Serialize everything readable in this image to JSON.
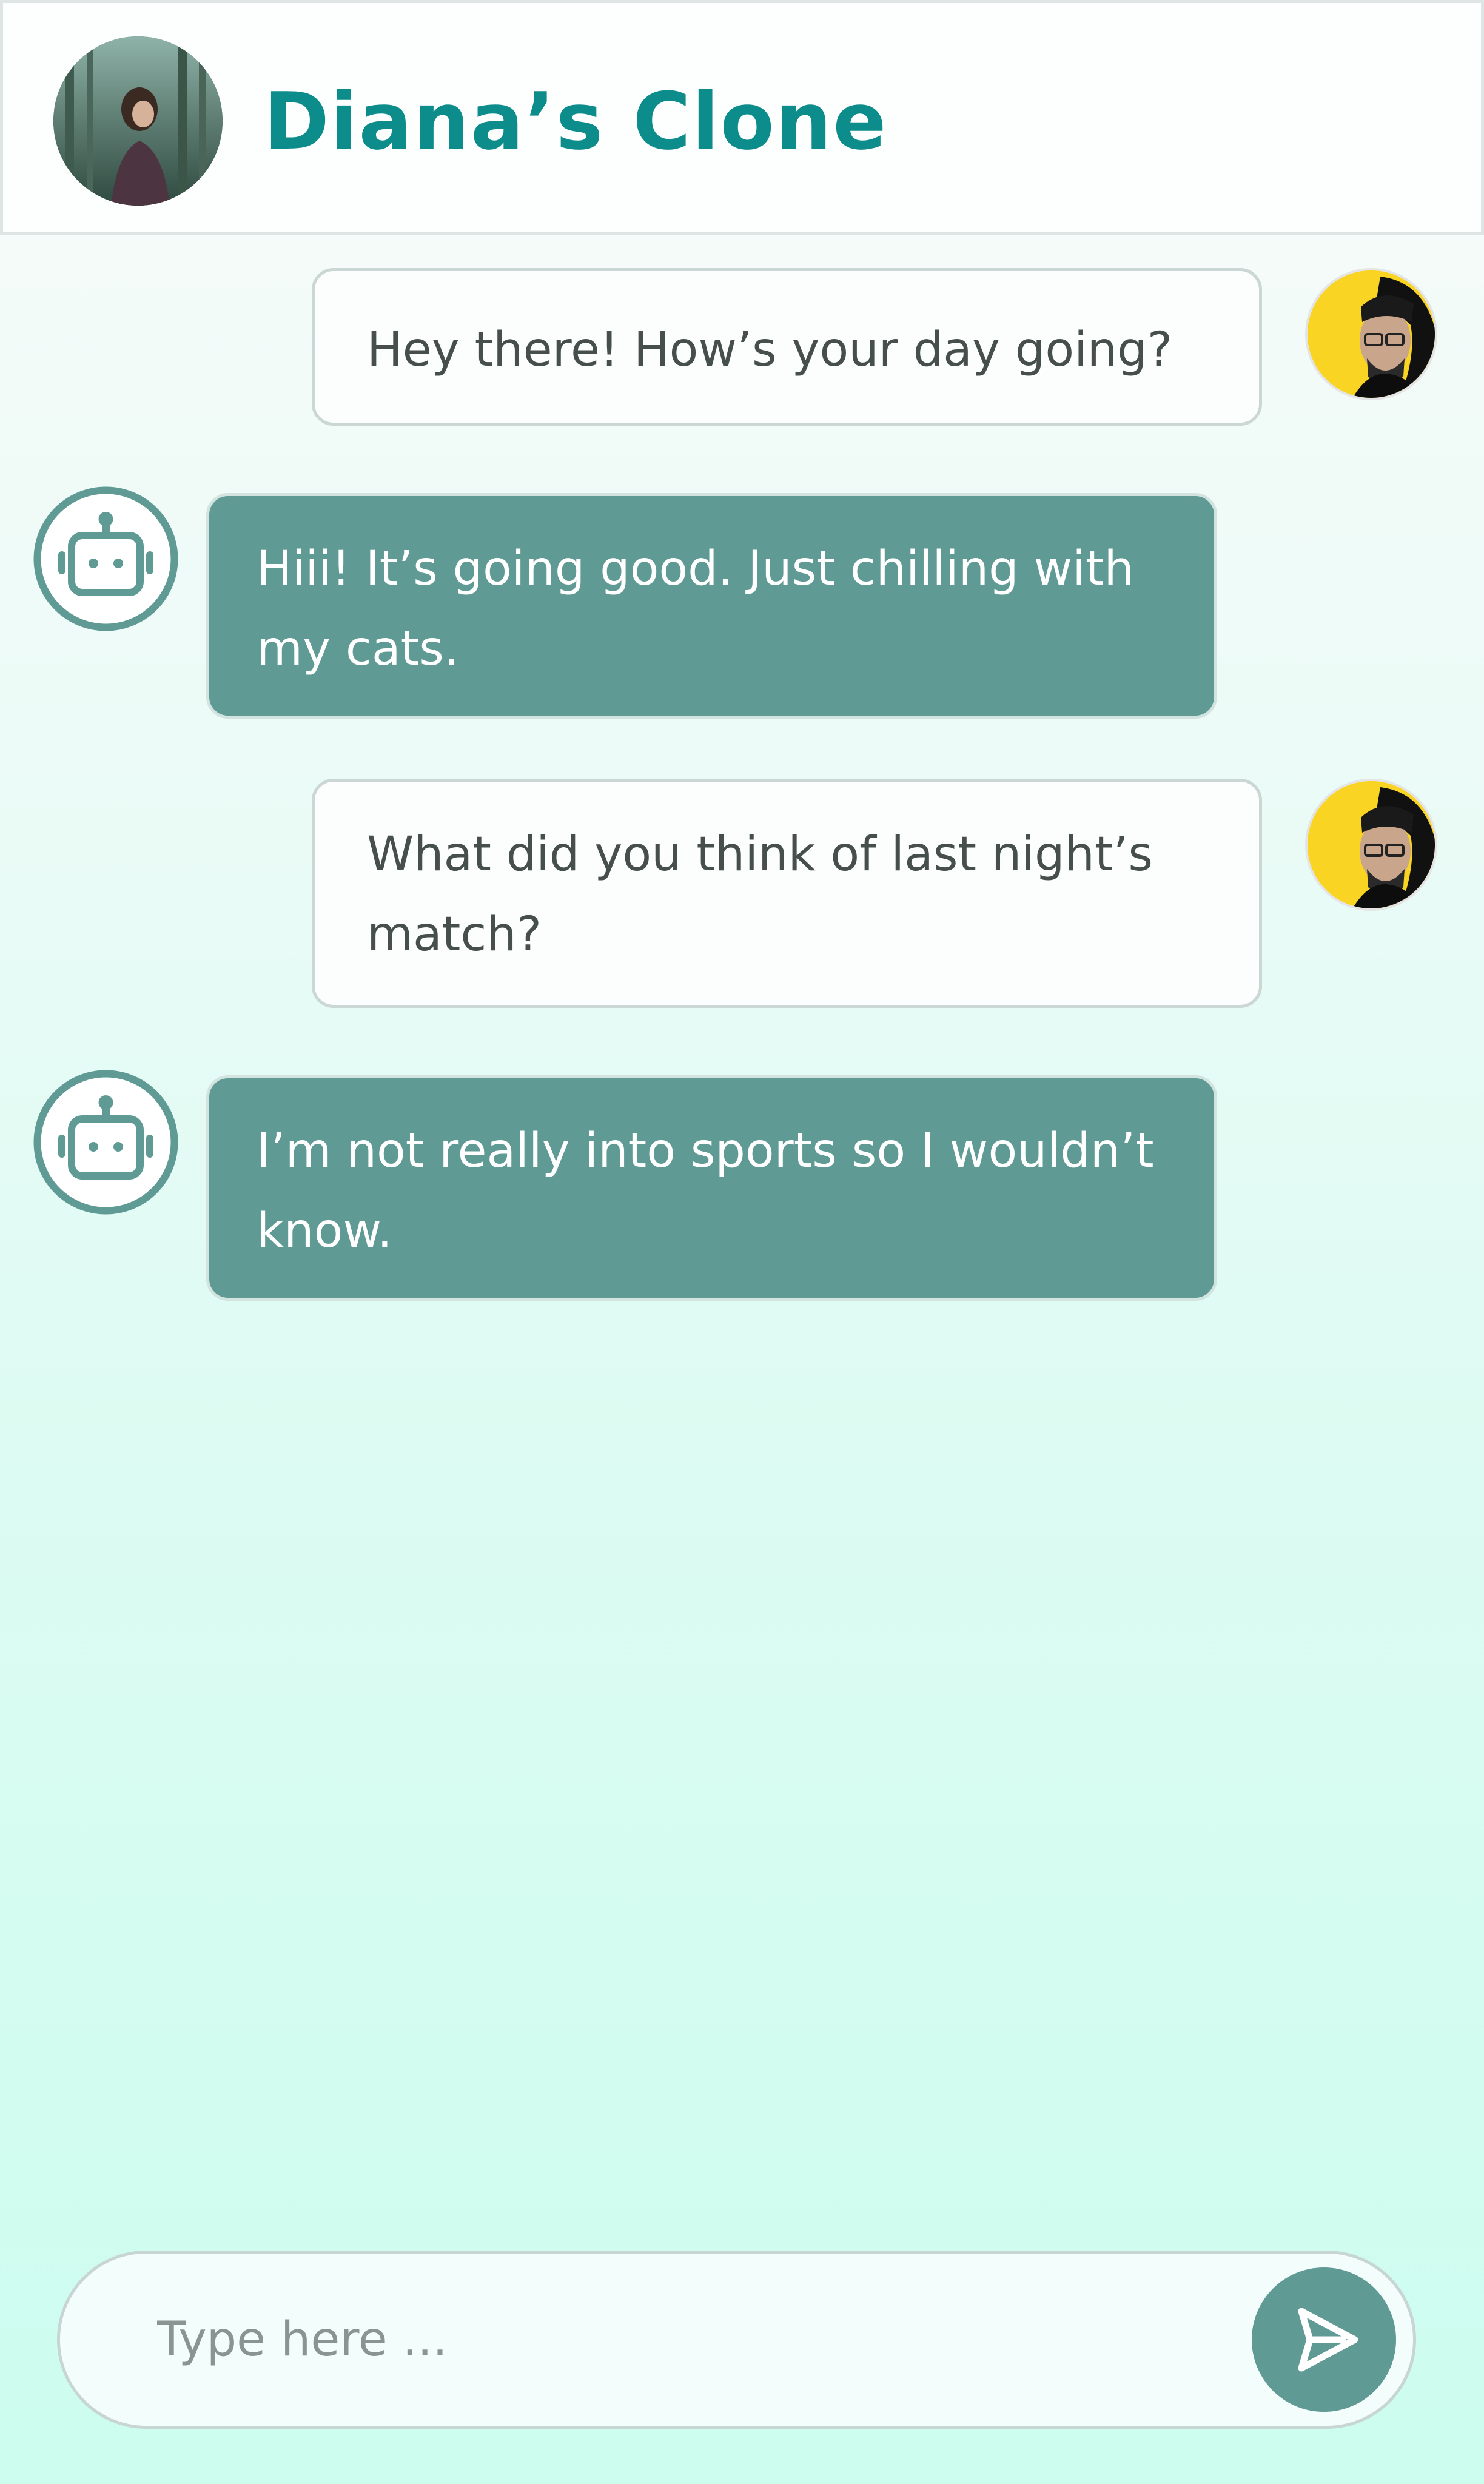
{
  "header": {
    "title": "Diana’s Clone",
    "avatar_icon": "profile-photo-woman-forest"
  },
  "messages": [
    {
      "sender": "user",
      "lines": [
        "Hey there! How’s your day going?"
      ]
    },
    {
      "sender": "bot",
      "lines": [
        "Hiii! It’s going good. Just chilling with",
        "my cats."
      ]
    },
    {
      "sender": "user",
      "lines": [
        "What did you think of last night’s",
        "match?"
      ]
    },
    {
      "sender": "bot",
      "lines": [
        "I’m not really into sports so I wouldn’t",
        "know."
      ]
    }
  ],
  "composer": {
    "placeholder": "Type here ...",
    "value": "",
    "send_icon": "send-icon"
  },
  "colors": {
    "accent": "#0c8c8a",
    "bot_bubble": "#5f9a94",
    "user_avatar_bg": "#f9d423"
  }
}
